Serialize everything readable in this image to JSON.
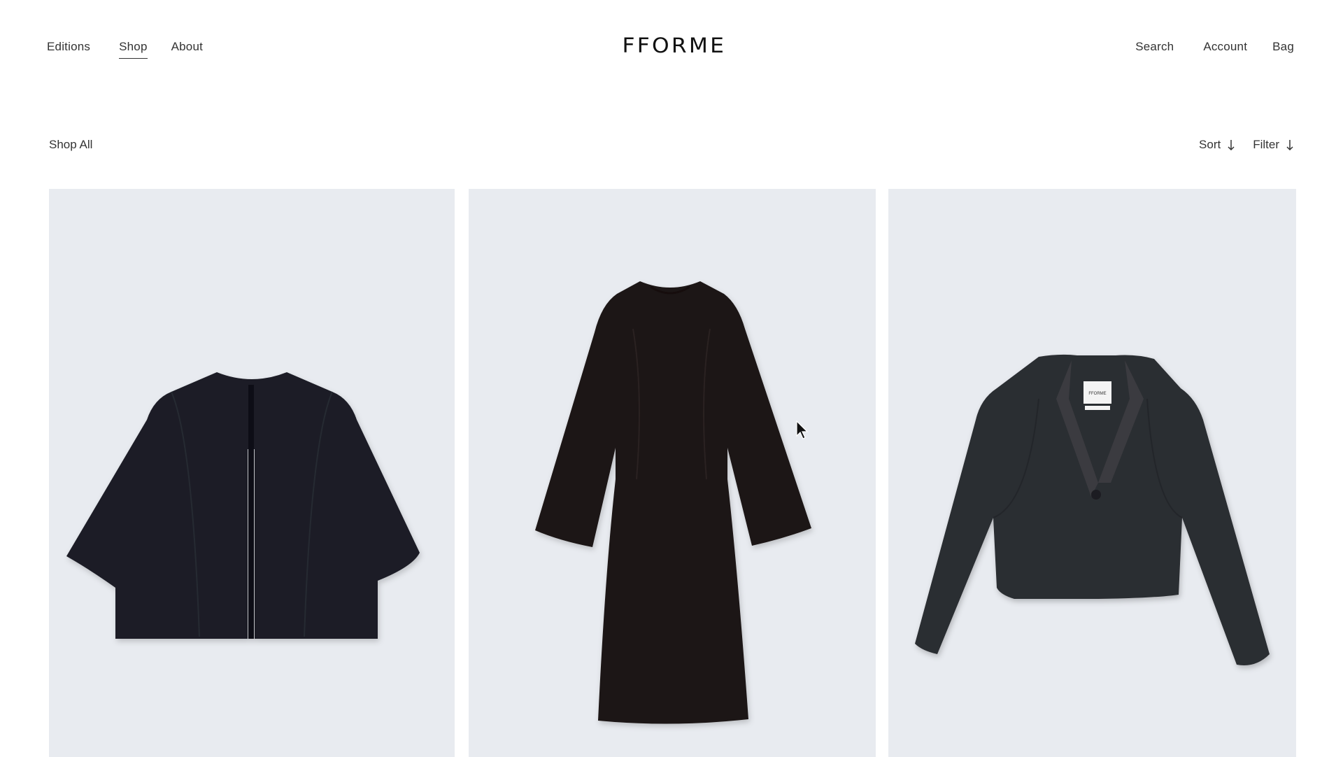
{
  "header": {
    "nav_left": {
      "editions": "Editions",
      "shop": "Shop",
      "about": "About"
    },
    "logo": "FFORME",
    "nav_right": {
      "search": "Search",
      "account": "Account",
      "bag": "Bag"
    }
  },
  "toolbar": {
    "title": "Shop All",
    "sort_label": "Sort",
    "filter_label": "Filter"
  },
  "products": [
    {
      "image": "black-cropped-cape-jacket",
      "background": "#e8ebf0",
      "garment_color": "#1c1f26"
    },
    {
      "image": "black-long-sleeve-maxi-dress",
      "background": "#e8ebf0",
      "garment_color": "#1e1716"
    },
    {
      "image": "black-leather-blazer",
      "background": "#e8ebf0",
      "garment_color": "#2c2d31"
    }
  ],
  "icons": {
    "sort_arrow": "arrow-down-icon",
    "filter_arrow": "arrow-down-icon",
    "cursor": "mouse-pointer-icon"
  }
}
